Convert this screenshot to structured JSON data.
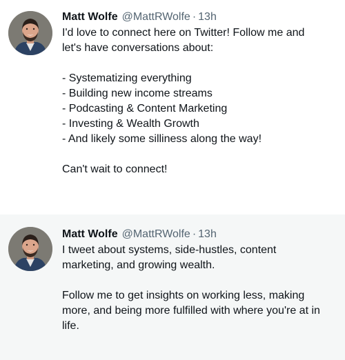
{
  "tweets": [
    {
      "author_name": "Matt Wolfe",
      "author_handle": "@MattRWolfe",
      "separator": "·",
      "time": "13h",
      "intro_line1": "I'd love to connect here on Twitter! Follow me and",
      "intro_line2": "let's have conversations about:",
      "bullets": [
        "- Systematizing everything",
        "- Building new income streams",
        "- Podcasting & Content Marketing",
        "- Investing & Wealth Growth",
        "- And likely some silliness along the way!"
      ],
      "outro": "Can't wait to connect!"
    },
    {
      "author_name": "Matt Wolfe",
      "author_handle": "@MattRWolfe",
      "separator": "·",
      "time": "13h",
      "para1_line1": "I tweet about systems, side-hustles, content",
      "para1_line2": "marketing, and growing wealth.",
      "para2_line1": "Follow me to get insights on working less, making",
      "para2_line2": "more, and being more fulfilled with where you're at in",
      "para2_line3": "life."
    }
  ],
  "colors": {
    "text": "#0f1419",
    "secondary_text": "#536471",
    "tweet2_background": "#f5f7f7"
  }
}
